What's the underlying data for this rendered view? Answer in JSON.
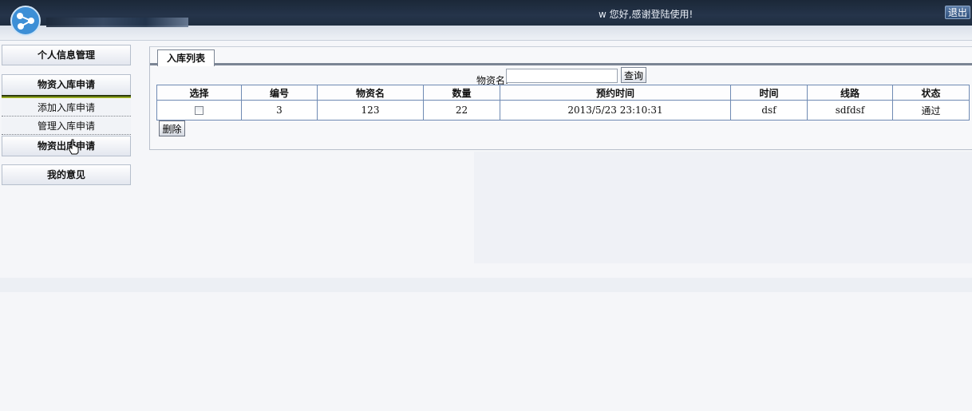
{
  "header": {
    "greeting": "w 您好,感谢登陆使用!",
    "logout_label": "退出"
  },
  "sidebar": {
    "items": [
      {
        "label": "个人信息管理"
      },
      {
        "label": "物资入库申请"
      },
      {
        "label": "物资出库申请"
      },
      {
        "label": "我的意见"
      }
    ],
    "sub_items": [
      {
        "label": "添加入库申请"
      },
      {
        "label": "管理入库申请"
      }
    ]
  },
  "main": {
    "tab_label": "入库列表",
    "search": {
      "label": "物资名:",
      "value": "",
      "button_label": "查询"
    },
    "table": {
      "headers": [
        "选择",
        "编号",
        "物资名",
        "数量",
        "预约时间",
        "时间",
        "线路",
        "状态"
      ],
      "rows": [
        {
          "id": "3",
          "name": "123",
          "quantity": "22",
          "reserve_time": "2013/5/23 23:10:31",
          "time": "dsf",
          "route": "sdfdsf",
          "status": "通过"
        }
      ]
    },
    "delete_label": "删除"
  },
  "colors": {
    "topbar": "#1f2d40",
    "table_border": "#6f8ab3",
    "active_accent": "#c8d838"
  }
}
